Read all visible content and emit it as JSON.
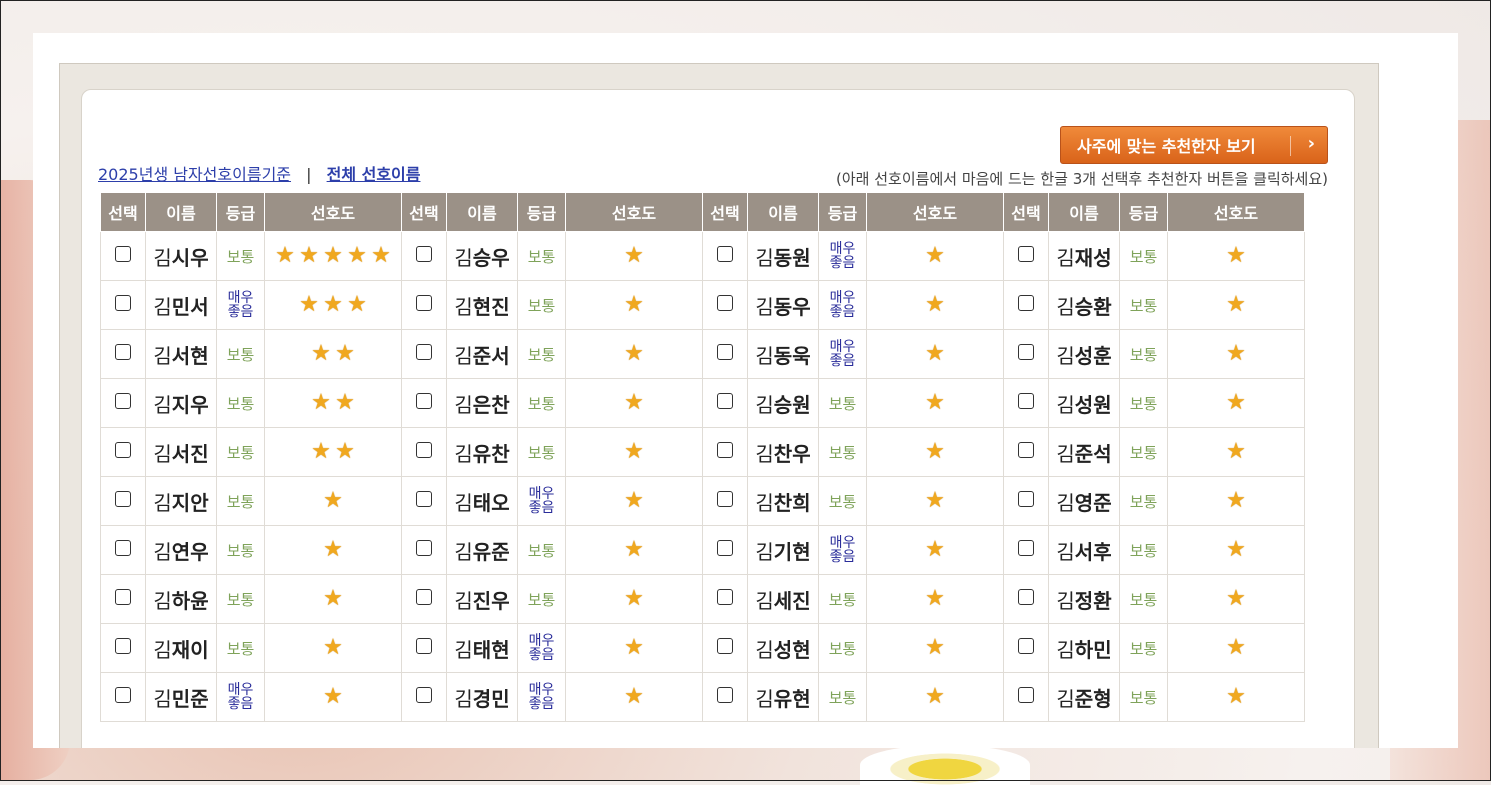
{
  "header": {
    "recommend_button": "사주에 맞는 추천한자 보기",
    "link_year": "2025년생 남자선호이름기준",
    "link_separator": "|",
    "link_all": "전체 선호이름",
    "hint": "(아래 선호이름에서 마음에 드는 한글 3개 선택후 추천한자 버튼을 클릭하세요)"
  },
  "table": {
    "headers": [
      "선택",
      "이름",
      "등급",
      "선호도"
    ],
    "grade_normal": "보통",
    "grade_good_line1": "매우",
    "grade_good_line2": "좋음",
    "surname": "김",
    "star_glyph": "★",
    "columns": [
      [
        {
          "given": "시우",
          "grade": "normal",
          "stars": 5
        },
        {
          "given": "민서",
          "grade": "good",
          "stars": 3
        },
        {
          "given": "서현",
          "grade": "normal",
          "stars": 2
        },
        {
          "given": "지우",
          "grade": "normal",
          "stars": 2
        },
        {
          "given": "서진",
          "grade": "normal",
          "stars": 2
        },
        {
          "given": "지안",
          "grade": "normal",
          "stars": 1
        },
        {
          "given": "연우",
          "grade": "normal",
          "stars": 1
        },
        {
          "given": "하윤",
          "grade": "normal",
          "stars": 1
        },
        {
          "given": "재이",
          "grade": "normal",
          "stars": 1
        },
        {
          "given": "민준",
          "grade": "good",
          "stars": 1
        }
      ],
      [
        {
          "given": "승우",
          "grade": "normal",
          "stars": 1
        },
        {
          "given": "현진",
          "grade": "normal",
          "stars": 1
        },
        {
          "given": "준서",
          "grade": "normal",
          "stars": 1
        },
        {
          "given": "은찬",
          "grade": "normal",
          "stars": 1
        },
        {
          "given": "유찬",
          "grade": "normal",
          "stars": 1
        },
        {
          "given": "태오",
          "grade": "good",
          "stars": 1
        },
        {
          "given": "유준",
          "grade": "normal",
          "stars": 1
        },
        {
          "given": "진우",
          "grade": "normal",
          "stars": 1
        },
        {
          "given": "태현",
          "grade": "good",
          "stars": 1
        },
        {
          "given": "경민",
          "grade": "good",
          "stars": 1
        }
      ],
      [
        {
          "given": "동원",
          "grade": "good",
          "stars": 1
        },
        {
          "given": "동우",
          "grade": "good",
          "stars": 1
        },
        {
          "given": "동욱",
          "grade": "good",
          "stars": 1
        },
        {
          "given": "승원",
          "grade": "normal",
          "stars": 1
        },
        {
          "given": "찬우",
          "grade": "normal",
          "stars": 1
        },
        {
          "given": "찬희",
          "grade": "normal",
          "stars": 1
        },
        {
          "given": "기현",
          "grade": "good",
          "stars": 1
        },
        {
          "given": "세진",
          "grade": "normal",
          "stars": 1
        },
        {
          "given": "성현",
          "grade": "normal",
          "stars": 1
        },
        {
          "given": "유현",
          "grade": "normal",
          "stars": 1
        }
      ],
      [
        {
          "given": "재성",
          "grade": "normal",
          "stars": 1
        },
        {
          "given": "승환",
          "grade": "normal",
          "stars": 1
        },
        {
          "given": "성훈",
          "grade": "normal",
          "stars": 1
        },
        {
          "given": "성원",
          "grade": "normal",
          "stars": 1
        },
        {
          "given": "준석",
          "grade": "normal",
          "stars": 1
        },
        {
          "given": "영준",
          "grade": "normal",
          "stars": 1
        },
        {
          "given": "서후",
          "grade": "normal",
          "stars": 1
        },
        {
          "given": "정환",
          "grade": "normal",
          "stars": 1
        },
        {
          "given": "하민",
          "grade": "normal",
          "stars": 1
        },
        {
          "given": "준형",
          "grade": "normal",
          "stars": 1
        }
      ]
    ]
  }
}
